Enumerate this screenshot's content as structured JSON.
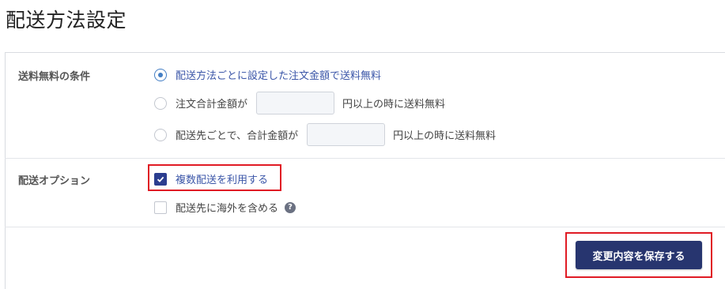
{
  "page": {
    "title": "配送方法設定"
  },
  "free_shipping": {
    "label": "送料無料の条件",
    "options": [
      {
        "label": "配送方法ごとに設定した注文金額で送料無料",
        "selected": true
      },
      {
        "label_before": "注文合計金額が",
        "input_value": "",
        "label_after": "円以上の時に送料無料",
        "selected": false
      },
      {
        "label_before": "配送先ごとで、合計金額が",
        "input_value": "",
        "label_after": "円以上の時に送料無料",
        "selected": false
      }
    ]
  },
  "delivery_options": {
    "label": "配送オプション",
    "options": [
      {
        "label": "複数配送を利用する",
        "checked": true
      },
      {
        "label": "配送先に海外を含める",
        "checked": false,
        "help": "?"
      }
    ]
  },
  "actions": {
    "save_label": "変更内容を保存する"
  },
  "colors": {
    "accent": "#437ec4",
    "button": "#27356f",
    "highlight": "#e01b24"
  }
}
